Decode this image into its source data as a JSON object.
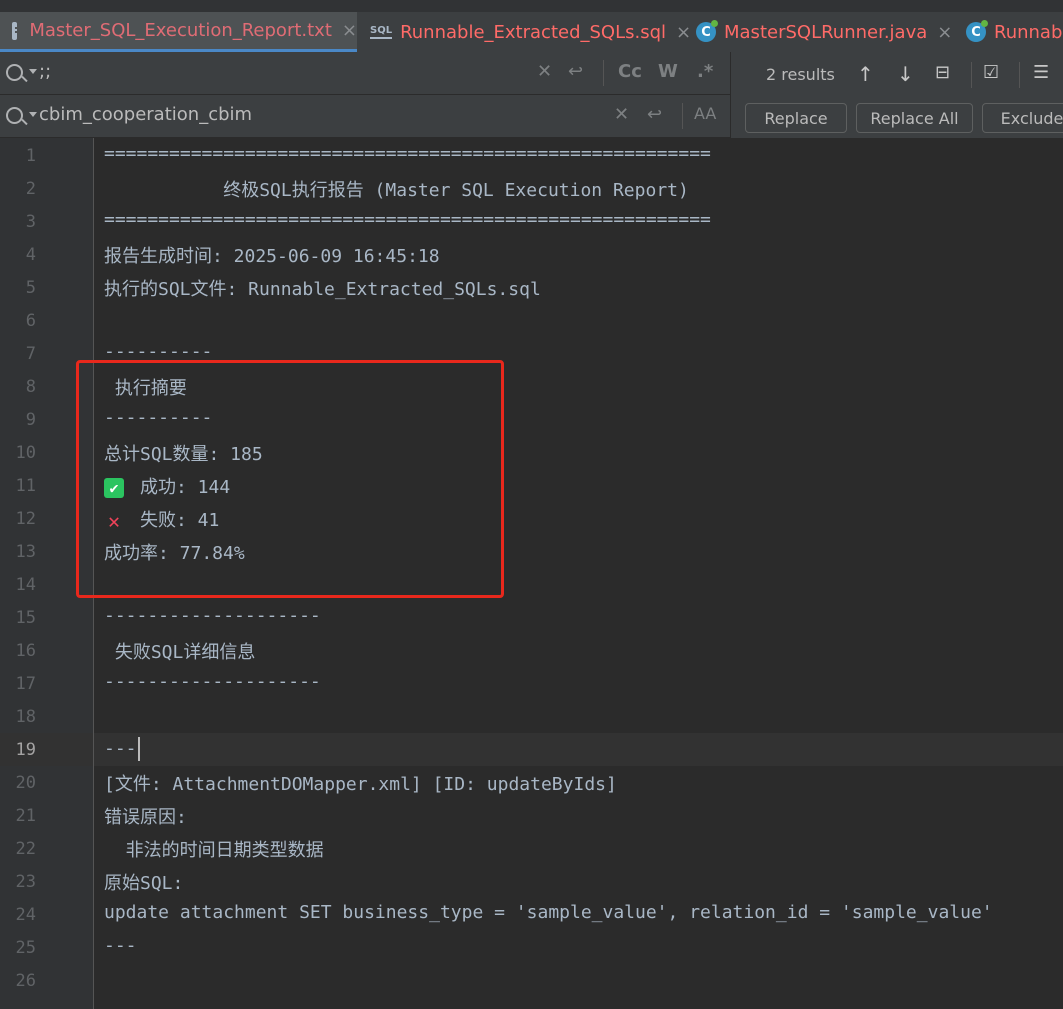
{
  "tabs": [
    {
      "label": "Master_SQL_Execution_Report.txt",
      "icon": "text-file-icon",
      "active": true
    },
    {
      "label": "Runnable_Extracted_SQLs.sql",
      "icon": "sql-file-icon",
      "active": false
    },
    {
      "label": "MasterSQLRunner.java",
      "icon": "java-class-icon",
      "active": false
    },
    {
      "label": "Runnab",
      "icon": "java-class-icon",
      "active": false
    }
  ],
  "find": {
    "search_value": ";;",
    "replace_value": "cbim_cooperation_cbim",
    "results": "2 results",
    "match_case_label": "Cc",
    "words_label": "W",
    "regex_label": ".*",
    "preserve_case_label": "AA",
    "replace_button": "Replace",
    "replace_all_button": "Replace All",
    "exclude_button": "Exclude"
  },
  "editor": {
    "current_line": 19,
    "lines": [
      "========================================================",
      "           终极SQL执行报告 (Master SQL Execution Report)",
      "========================================================",
      "报告生成时间: 2025-06-09 16:45:18",
      "执行的SQL文件: Runnable_Extracted_SQLs.sql",
      "",
      "----------",
      " 执行摘要",
      "----------",
      "总计SQL数量: 185",
      "成功: 144",
      "失败: 41",
      "成功率: 77.84%",
      "",
      "--------------------",
      " 失败SQL详细信息",
      "--------------------",
      "",
      "---",
      "[文件: AttachmentDOMapper.xml] [ID: updateByIds]",
      "错误原因:",
      "  非法的时间日期类型数据",
      "原始SQL:",
      "update attachment SET business_type = 'sample_value', relation_id = 'sample_value'",
      "---",
      ""
    ]
  },
  "icons": {
    "success": "check-mark-icon",
    "failure": "cross-mark-icon"
  },
  "colors": {
    "highlight_box": "#e8281c",
    "active_tab_text": "#e06c75",
    "check": "#2bc460",
    "cross": "#f0435a"
  }
}
